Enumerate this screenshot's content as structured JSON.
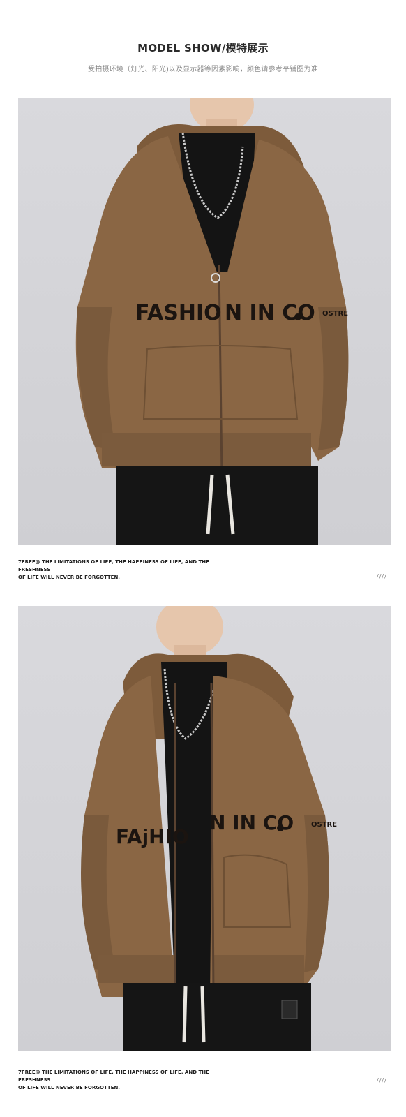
{
  "header": {
    "title": "MODEL SHOW/模特展示",
    "subtitle": "受拍摄环境（灯光、阳光)以及显示器等因素影响，颜色请参考平铺图为准"
  },
  "photos": [
    {
      "print_left": "FASHIO",
      "print_right": "N IN CO",
      "sleeve_print": "OSTRE",
      "caption_line1": "7FREE@ THE LIMITATIONS OF LIFE, THE HAPPINESS OF LIFE, AND THE FRESHNESS",
      "caption_line2": "OF LIFE WILL NEVER BE FORGOTTEN.",
      "slashes": "////"
    },
    {
      "print_left": "FAjHIO",
      "print_right": "N IN CO",
      "sleeve_print": "OSTRE",
      "caption_line1": "7FREE@ THE LIMITATIONS OF LIFE, THE HAPPINESS OF LIFE, AND THE FRESHNESS",
      "caption_line2": "OF LIFE WILL NEVER BE FORGOTTEN.",
      "slashes": "////"
    }
  ],
  "colors": {
    "hoodie": "#8a6644",
    "backdrop": "#d4d4d8",
    "shirt": "#121212"
  }
}
